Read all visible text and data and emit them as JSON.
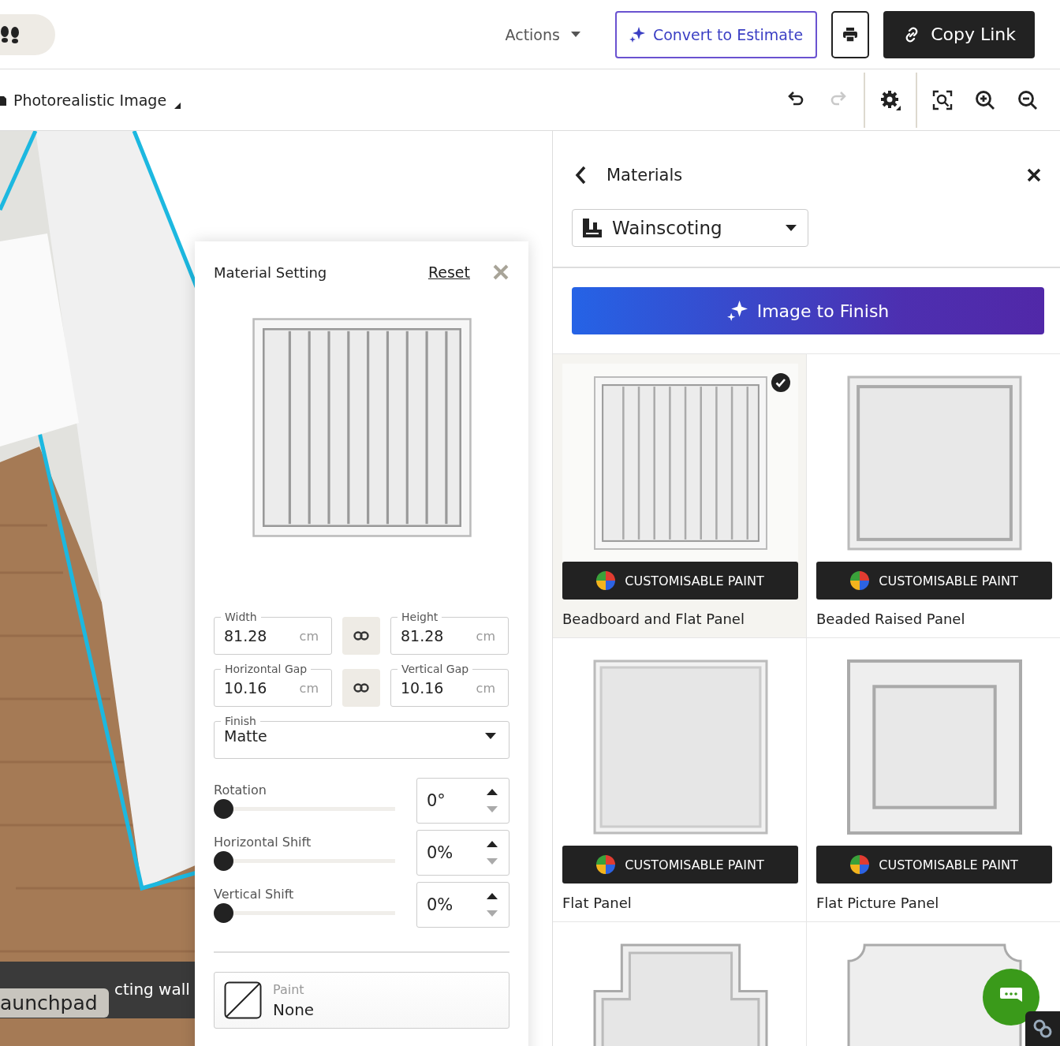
{
  "header": {
    "actions_menu": "Actions",
    "buttons": [
      {
        "kind": "ai",
        "label": "Convert to Estimate"
      },
      {
        "kind": "print"
      },
      {
        "kind": "dark",
        "label": "Copy Link"
      }
    ]
  },
  "toolbar": {
    "view_selector": "Photorealistic Image",
    "tools": [
      {
        "kind": "undo",
        "disabled": false
      },
      {
        "kind": "redo",
        "disabled": true
      },
      {
        "kind": "settings",
        "disabled": false
      },
      {
        "kind": "fit",
        "disabled": false
      },
      {
        "kind": "zoom_in",
        "disabled": false
      },
      {
        "kind": "zoom_out",
        "disabled": false
      }
    ]
  },
  "canvas": {
    "status_text": "cting wall",
    "tooltip": "aunchpad"
  },
  "material_setting": {
    "title": "Material Setting",
    "reset": "Reset",
    "preview": {
      "kind": "beadboard"
    },
    "field_rows": [
      {
        "left": {
          "label": "Width",
          "value": "81.28",
          "unit": "cm"
        },
        "right": {
          "label": "Height",
          "value": "81.28",
          "unit": "cm"
        }
      },
      {
        "left": {
          "label": "Horizontal Gap",
          "value": "10.16",
          "unit": "cm"
        },
        "right": {
          "label": "Vertical Gap",
          "value": "10.16",
          "unit": "cm"
        }
      }
    ],
    "finish": {
      "label": "Finish",
      "value": "Matte"
    },
    "adjustments": [
      {
        "label": "Rotation",
        "level": 0,
        "value": "0°"
      },
      {
        "label": "Horizontal Shift",
        "level": 0,
        "value": "0%"
      },
      {
        "label": "Vertical Shift",
        "level": 0,
        "value": "0%"
      }
    ],
    "paint": {
      "label": "Paint",
      "value": "None"
    }
  },
  "materials_panel": {
    "title": "Materials",
    "category": "Wainscoting",
    "ai_button": "Image to Finish",
    "items": [
      {
        "name": "Beadboard and Flat Panel",
        "badge": "CUSTOMISABLE PAINT",
        "kind": "beadboard",
        "selected": true
      },
      {
        "name": "Beaded Raised Panel",
        "badge": "CUSTOMISABLE PAINT",
        "kind": "raised",
        "selected": false
      },
      {
        "name": "Flat Panel",
        "badge": "CUSTOMISABLE PAINT",
        "kind": "flat",
        "selected": false
      },
      {
        "name": "Flat Picture Panel",
        "badge": "CUSTOMISABLE PAINT",
        "kind": "picture",
        "selected": false
      },
      {
        "kind": "notched",
        "selected": false
      },
      {
        "kind": "scalloped",
        "selected": false
      }
    ]
  }
}
